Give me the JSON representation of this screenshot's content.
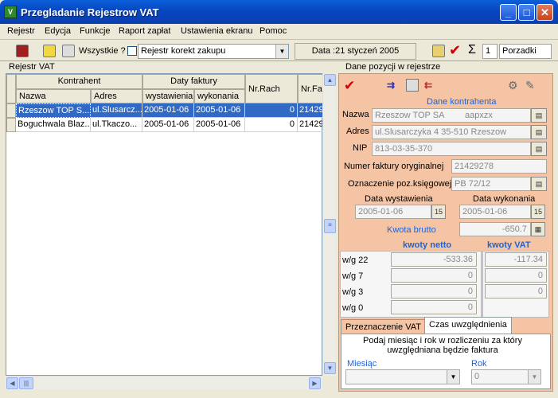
{
  "window": {
    "title": "Przegladanie Rejestrow VAT",
    "icon": "vat-app-icon"
  },
  "menu": [
    "Rejestr",
    "Edycja",
    "Funkcje",
    "Raport zapłat",
    "Ustawienia ekranu",
    "Pomoc"
  ],
  "toolbar": {
    "all_label": "Wszystkie ?",
    "register_combo": "Rejestr korekt zakupu",
    "date_label": "Data :21 styczeń 2005",
    "number_value": "1",
    "sort_value": "Porzadki"
  },
  "left": {
    "title": "Rejestr VAT",
    "header_groups": {
      "contractor": "Kontrahent",
      "invoice_dates": "Daty faktury"
    },
    "columns": {
      "name": "Nazwa",
      "address": "Adres",
      "issued": "wystawienia",
      "performed": "wykonania",
      "nr_rach": "Nr.Rach",
      "nr_fak": "Nr.Fak"
    },
    "rows": [
      {
        "name": "Rzeszow TOP S...",
        "address": "ul.Slusarcz...",
        "issued": "2005-01-06",
        "performed": "2005-01-06",
        "nr_rach": "0",
        "nr_fak": "21429"
      },
      {
        "name": "Boguchwala Blaz...",
        "address": "ul.Tkaczo...",
        "issued": "2005-01-06",
        "performed": "2005-01-06",
        "nr_rach": "0",
        "nr_fak": "21429"
      }
    ]
  },
  "right": {
    "title": "Dane pozycji w rejestrze",
    "contractor_header": "Dane kontrahenta",
    "name_label": "Nazwa",
    "name_value": "Rzeszow TOP SA",
    "name_code": "aapxzx",
    "address_label": "Adres",
    "address_value": "ul.Slusarczyka 4 35-510 Rzeszow",
    "nip_label": "NIP",
    "nip_value": "813-03-35-370",
    "orig_invoice_label": "Numer faktury oryginalnej",
    "orig_invoice_value": "21429278",
    "book_label": "Oznaczenie poz.księgowej",
    "book_value": "PB 72/12",
    "issue_date_label": "Data wystawienia",
    "issue_date_value": "2005-01-06",
    "perform_date_label": "Data wykonania",
    "perform_date_value": "2005-01-06",
    "gross_label": "Kwota brutto",
    "gross_value": "-650.7",
    "net_header": "kwoty netto",
    "vat_header": "kwoty VAT",
    "rates": [
      {
        "label": "w/g 22",
        "net": "-533.36",
        "vat": "-117.34"
      },
      {
        "label": "w/g 7",
        "net": "0",
        "vat": "0"
      },
      {
        "label": "w/g 3",
        "net": "0",
        "vat": "0"
      },
      {
        "label": "w/g 0",
        "net": "0",
        "vat": ""
      }
    ],
    "tabs": [
      "Przeznaczenie VAT",
      "Czas uwzględnienia"
    ],
    "note": "Podaj miesiąc i rok w rozliczeniu za który uwzględniana będzie faktura",
    "month_label": "Miesiąc",
    "year_label": "Rok",
    "year_value": "0"
  },
  "colors": {
    "title_bar": "#0a5fd8",
    "panel": "#f4c4a4",
    "selection": "#316ac5",
    "accent_red": "#d00000"
  }
}
